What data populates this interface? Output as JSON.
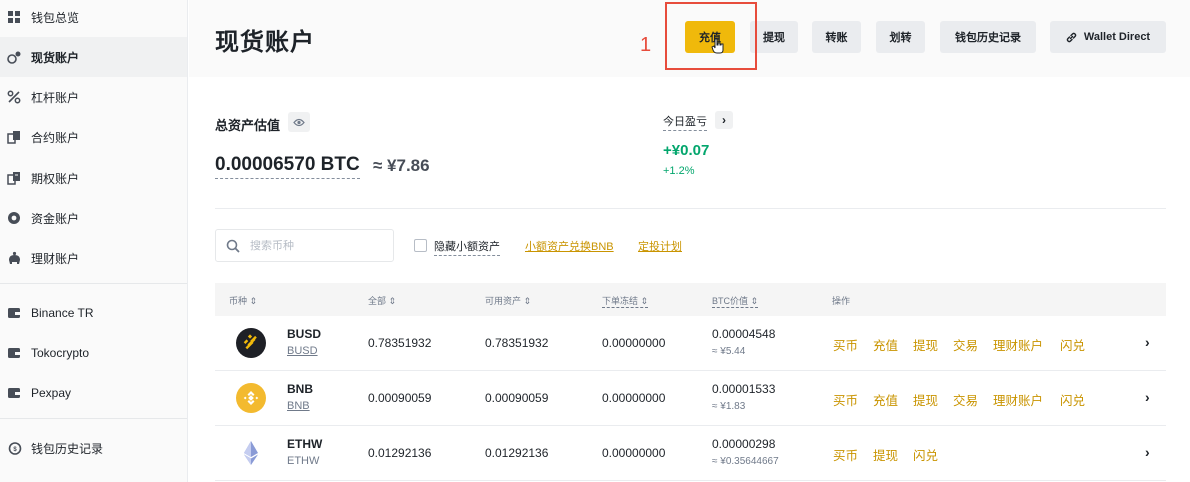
{
  "sidebar": {
    "items": [
      {
        "label": "钱包总览"
      },
      {
        "label": "现货账户"
      },
      {
        "label": "杠杆账户"
      },
      {
        "label": "合约账户"
      },
      {
        "label": "期权账户"
      },
      {
        "label": "资金账户"
      },
      {
        "label": "理财账户"
      },
      {
        "label": "Binance TR"
      },
      {
        "label": "Tokocrypto"
      },
      {
        "label": "Pexpay"
      },
      {
        "label": "钱包历史记录"
      }
    ]
  },
  "header": {
    "title": "现货账户",
    "step_number": "1",
    "buttons": {
      "deposit": "充值",
      "withdraw": "提现",
      "transfer": "转账",
      "internal_transfer": "划转",
      "history": "钱包历史记录",
      "wallet_direct": "Wallet Direct"
    }
  },
  "balance": {
    "label": "总资产估值",
    "btc": "0.00006570 BTC",
    "cny": "≈ ¥7.86",
    "pnl_label": "今日盈亏",
    "pnl_value": "+¥0.07",
    "pnl_pct": "+1.2%"
  },
  "filters": {
    "search_placeholder": "搜索币种",
    "hide_small": "隐藏小额资产",
    "convert_bnb": "小额资产兑换BNB",
    "auto_invest": "定投计划"
  },
  "table": {
    "headers": {
      "coin": "币种 ⇕",
      "total": "全部 ⇕",
      "available": "可用资产 ⇕",
      "in_order": "下单冻结 ⇕",
      "btc_value": "BTC价值 ⇕",
      "action": "操作"
    },
    "rows": [
      {
        "symbol": "BUSD",
        "name": "BUSD",
        "total": "0.78351932",
        "available": "0.78351932",
        "in_order": "0.00000000",
        "btc": "0.00004548",
        "cny": "≈ ¥5.44",
        "actions": [
          "买币",
          "充值",
          "提现",
          "交易",
          "理财账户",
          "闪兑"
        ]
      },
      {
        "symbol": "BNB",
        "name": "BNB",
        "total": "0.00090059",
        "available": "0.00090059",
        "in_order": "0.00000000",
        "btc": "0.00001533",
        "cny": "≈ ¥1.83",
        "actions": [
          "买币",
          "充值",
          "提现",
          "交易",
          "理财账户",
          "闪兑"
        ]
      },
      {
        "symbol": "ETHW",
        "name": "ETHW",
        "total": "0.01292136",
        "available": "0.01292136",
        "in_order": "0.00000000",
        "btc": "0.00000298",
        "cny": "≈ ¥0.35644667",
        "actions": [
          "买币",
          "提现",
          "闪兑"
        ]
      }
    ]
  },
  "colors": {
    "brand": "#f0b90b",
    "link": "#c99400",
    "positive": "#03a66d",
    "highlight": "#e74c3c"
  }
}
